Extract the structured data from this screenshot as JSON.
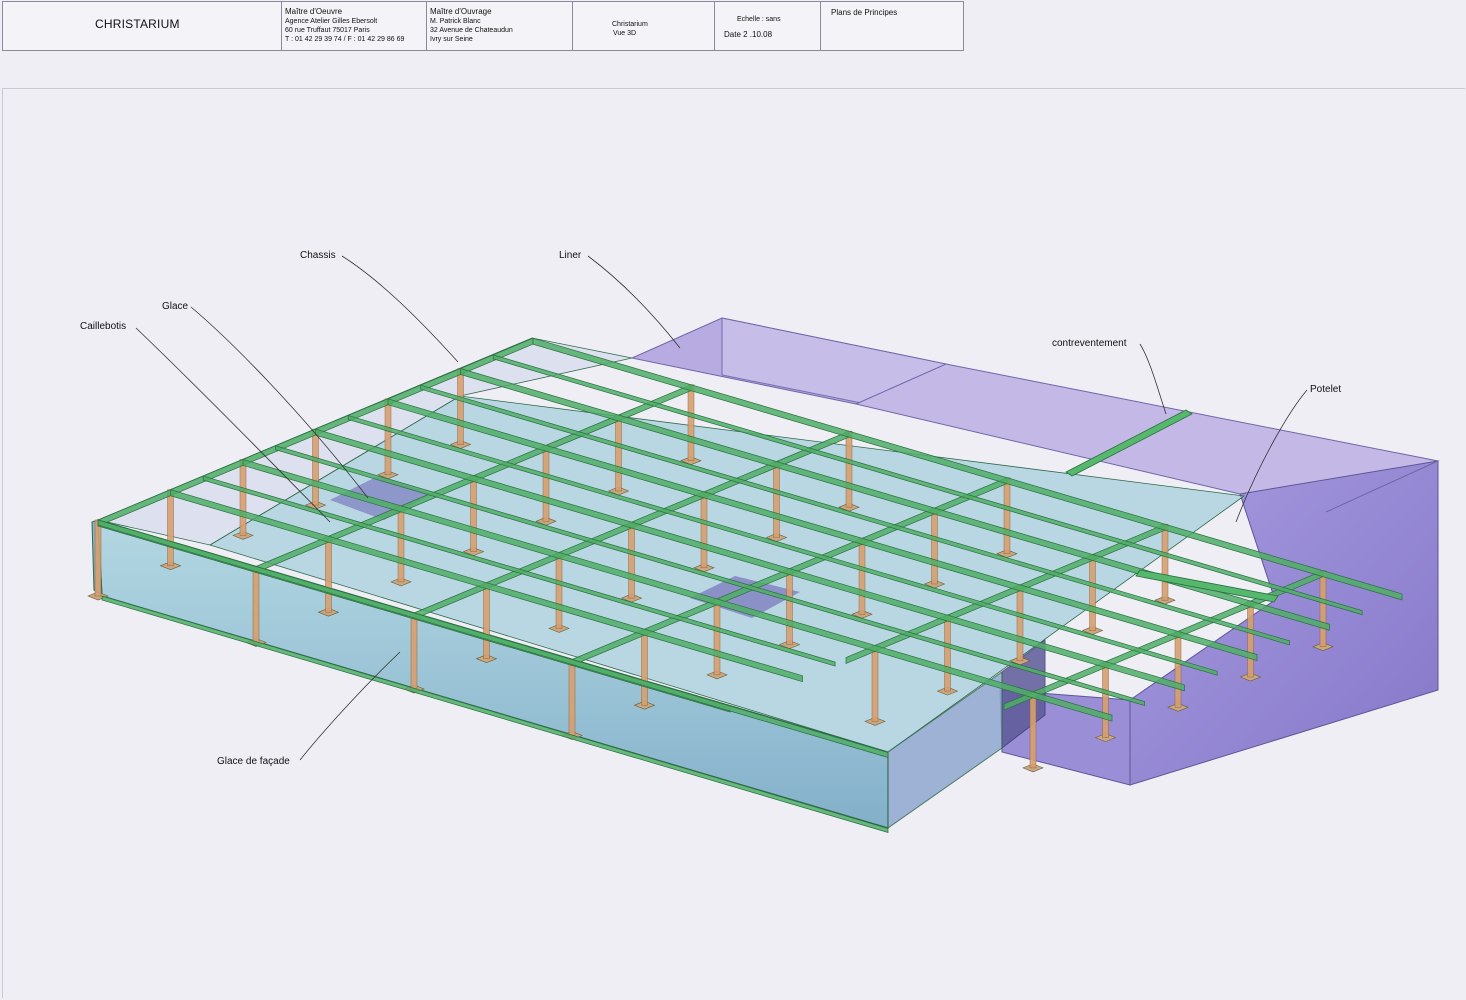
{
  "title_block": {
    "project": "CHRISTARIUM",
    "maitre_oeuvre": {
      "heading": "Maître d'Oeuvre",
      "line1": "Agence Atelier Gilles Ebersolt",
      "line2": "60 rue Truffaut 75017 Paris",
      "line3": "T : 01 42 29 39 74 / F : 01 42 29 86 69"
    },
    "maitre_ouvrage": {
      "heading": "Maître d'Ouvrage",
      "line1": "M. Patrick Blanc",
      "line2": "32 Avenue de Chateaudun",
      "line3": "Ivry sur Seine"
    },
    "view": {
      "line1": "Christarium",
      "line2": "Vue 3D"
    },
    "scale": "Echelle : sans",
    "date": "Date 2 .10.08",
    "sheet_title": "Plans de Principes"
  },
  "labels": {
    "chassis": "Chassis",
    "liner": "Liner",
    "glace": "Glace",
    "caillebotis": "Caillebotis",
    "contreventement": "contreventement",
    "potelet": "Potelet",
    "glace_facade": "Glace de façade"
  },
  "colors": {
    "liner": "#a89ad6",
    "glass": "#7fb3c9",
    "frame": "#4fae66",
    "post": "#d7a070",
    "plate": "#c9a880"
  }
}
